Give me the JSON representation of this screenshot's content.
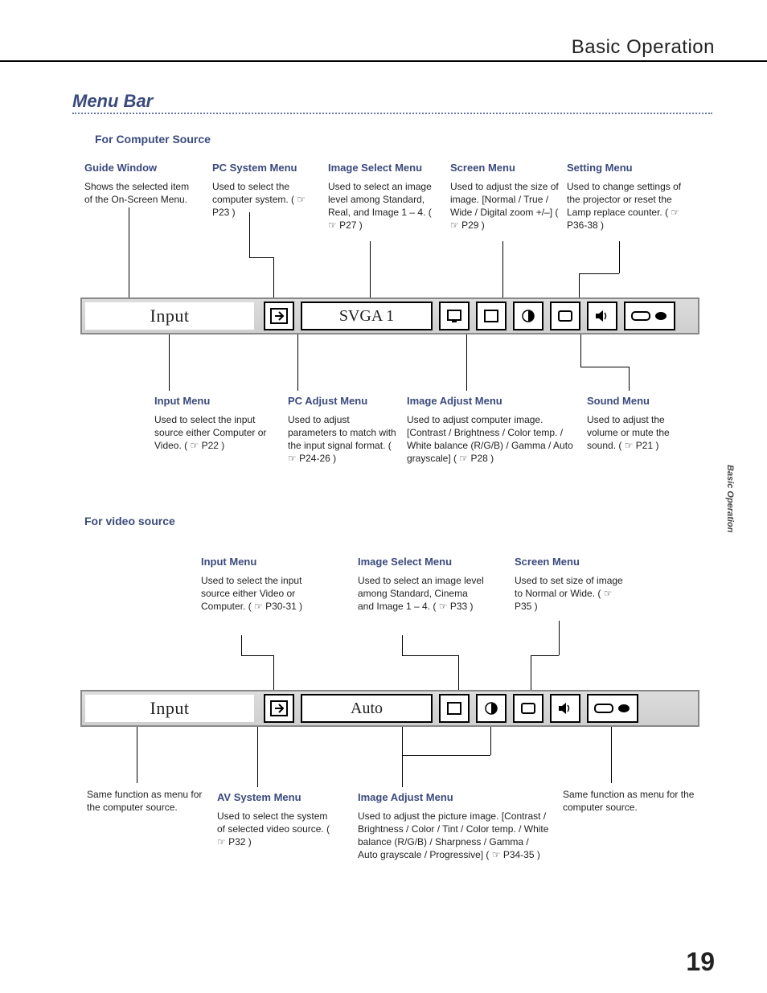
{
  "running_head": "Basic Operation",
  "section_title": "Menu Bar",
  "side_tab": "Basic Operation",
  "page_num": "19",
  "sub_computer": "For  Computer  Source",
  "sub_video": "For video source",
  "bar1": {
    "input_label": "Input",
    "system_label": "SVGA 1"
  },
  "bar2": {
    "input_label": "Input",
    "system_label": "Auto"
  },
  "top": {
    "guide": {
      "h": "Guide Window",
      "b": "Shows the selected item of the On-Screen Menu."
    },
    "pcsys": {
      "h": "PC System Menu",
      "b": "Used to select the computer system. ( ☞ P23 )"
    },
    "imgsel": {
      "h": "Image Select Menu",
      "b": "Used to select an image level among Standard, Real, and Image 1 – 4. ( ☞ P27 )"
    },
    "screen": {
      "h": "Screen Menu",
      "b": "Used to adjust the size of image. [Normal / True / Wide / Digital zoom +/–] ( ☞ P29 )"
    },
    "setting": {
      "h": "Setting Menu",
      "b": "Used to change settings of the projector or reset the Lamp replace counter. ( ☞ P36-38 )"
    }
  },
  "mid": {
    "input": {
      "h": "Input Menu",
      "b": "Used to select the input source either Computer or Video. ( ☞ P22 )"
    },
    "pcadj": {
      "h": "PC Adjust Menu",
      "b": "Used to adjust parameters to match with the input signal format. ( ☞ P24-26 )"
    },
    "imgadj": {
      "h": "Image Adjust Menu",
      "b": "Used to adjust computer image. [Contrast / Brightness / Color temp. / White balance (R/G/B) / Gamma / Auto grayscale] ( ☞ P28 )"
    },
    "sound": {
      "h": "Sound Menu",
      "b": "Used to adjust the volume or mute the sound. ( ☞ P21 )"
    }
  },
  "vidtop": {
    "input": {
      "h": "Input Menu",
      "b": "Used to select the input source either Video or Computer. ( ☞ P30-31 )"
    },
    "imgsel": {
      "h": "Image Select Menu",
      "b": "Used to select an image level among Standard, Cinema and Image 1 – 4. ( ☞ P33 )"
    },
    "screen": {
      "h": "Screen Menu",
      "b": "Used to set size of image to Normal or Wide. ( ☞ P35 )"
    }
  },
  "vidbot": {
    "same_left": "Same function as menu for the computer source.",
    "avsys": {
      "h": "AV System Menu",
      "b": "Used to select the system of selected video source. ( ☞ P32 )"
    },
    "imgadj": {
      "h": "Image Adjust Menu",
      "b": "Used to adjust the picture image. [Contrast / Brightness / Color / Tint / Color temp. / White balance (R/G/B) / Sharpness / Gamma / Auto grayscale / Progressive] ( ☞ P34-35 )"
    },
    "same_right": "Same function as menu for the computer source."
  }
}
